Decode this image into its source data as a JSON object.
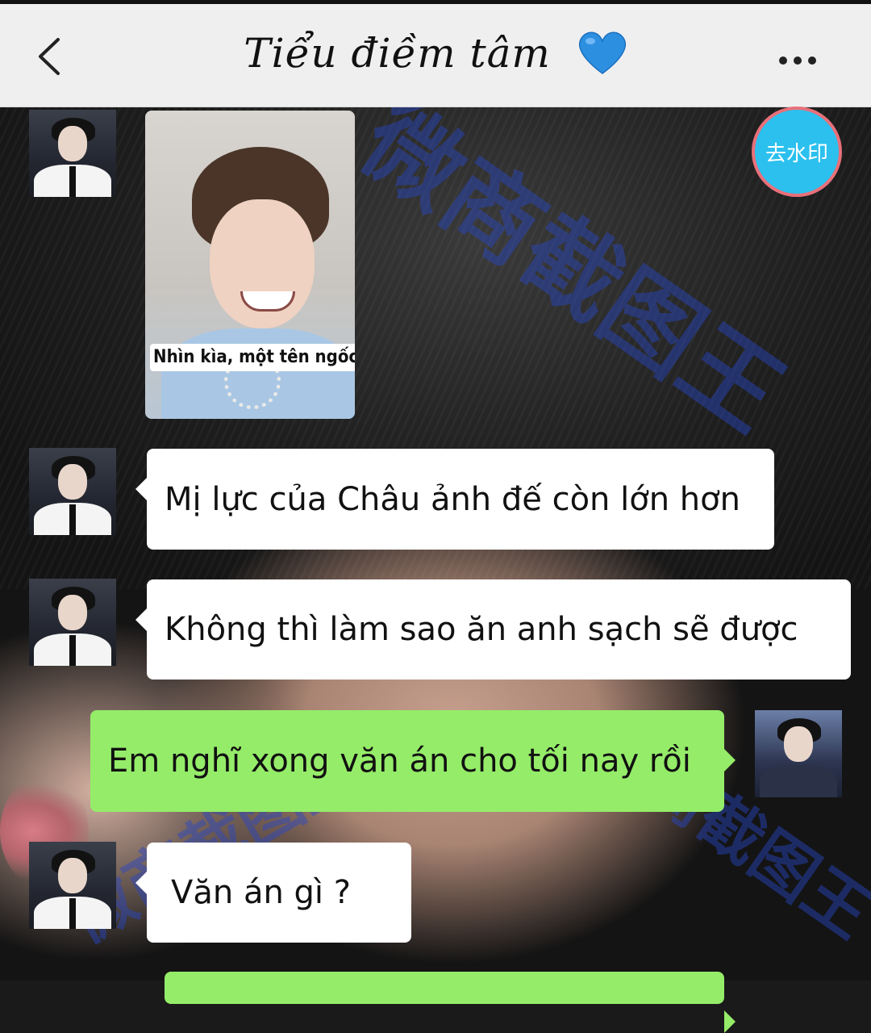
{
  "header": {
    "title": "Tiểu điềm tâm",
    "title_icon": "blue-heart-icon",
    "back_icon": "chevron-left-icon",
    "more_icon": "more-dots-icon"
  },
  "remove_watermark_button": "去水印",
  "watermark_text": "微商截图王",
  "messages": [
    {
      "side": "left",
      "type": "image",
      "caption": "Nhìn kìa, một tên ngốc"
    },
    {
      "side": "left",
      "type": "text",
      "text": "Mị lực của Châu ảnh đế còn lớn hơn"
    },
    {
      "side": "left",
      "type": "text",
      "text": "Không thì làm sao ăn anh sạch sẽ được"
    },
    {
      "side": "right",
      "type": "text",
      "text": "Em nghĩ xong văn án cho tối nay rồi"
    },
    {
      "side": "left",
      "type": "text",
      "text": "Văn án gì ?"
    }
  ],
  "colors": {
    "header_bg": "#efefef",
    "sent_bubble": "#95ec69",
    "received_bubble": "#ffffff",
    "heart": "#2d8fe0",
    "remove_button_bg": "#2bc0ee",
    "remove_button_border": "#e8707a"
  }
}
